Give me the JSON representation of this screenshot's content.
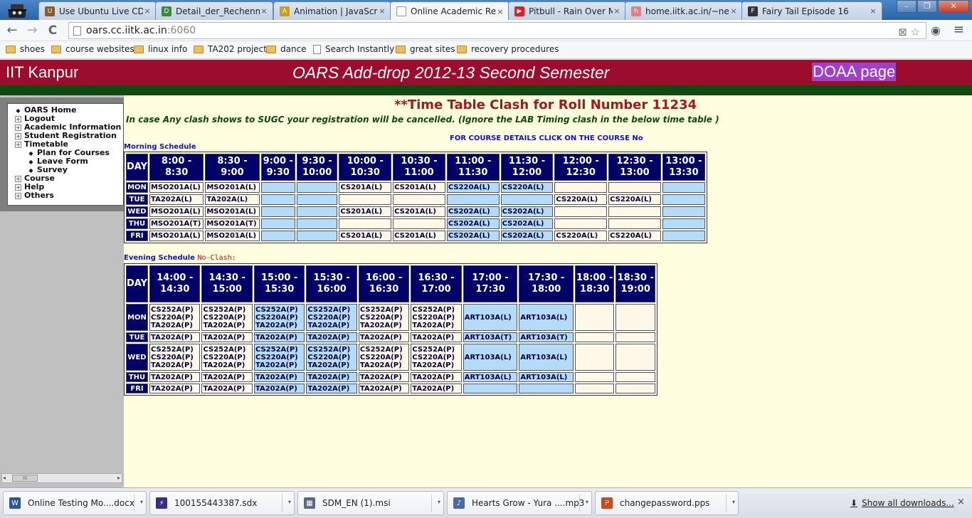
{
  "browser": {
    "tabs": [
      {
        "label": "Use Ubuntu Live CD",
        "color": "#8b5a2b",
        "glyph": "U"
      },
      {
        "label": "Detail_der_Rechenm",
        "color": "#3a8a3a",
        "glyph": "D"
      },
      {
        "label": "Animation | JavaScri",
        "color": "#c8a020",
        "glyph": "A"
      },
      {
        "label": "Online Academic Re",
        "color": "#ffffff",
        "glyph": "",
        "active": true
      },
      {
        "label": "Pitbull - Rain Over M",
        "color": "#e02020",
        "glyph": "▶"
      },
      {
        "label": "home.iitk.ac.in/~nee",
        "color": "#e08080",
        "glyph": "h"
      },
      {
        "label": "Fairy Tail Episode 16",
        "color": "#333333",
        "glyph": "F"
      }
    ],
    "tab_close_glyph": "×",
    "window_buttons": {
      "minimize": "–",
      "restore": "❐",
      "close": "✕"
    },
    "nav": {
      "back": "←",
      "forward": "→",
      "reload": "C"
    },
    "url": {
      "host": "oars.cc.iitk.ac.in",
      "port": ":6060"
    },
    "omni_icons": "⊠ ☆",
    "toolbar_icons": {
      "eye": "◉",
      "wrench": "≡"
    },
    "bookmarks": [
      {
        "label": "shoes",
        "type": "folder"
      },
      {
        "label": "course websites",
        "type": "folder"
      },
      {
        "label": "linux info",
        "type": "folder"
      },
      {
        "label": "TA202 project",
        "type": "folder"
      },
      {
        "label": "dance",
        "type": "folder"
      },
      {
        "label": "Search Instantly",
        "type": "page"
      },
      {
        "label": "great sites",
        "type": "folder"
      },
      {
        "label": "recovery procedures",
        "type": "folder"
      }
    ]
  },
  "banner": {
    "left": "IIT Kanpur",
    "center": "OARS Add-drop 2012-13 Second Semester",
    "right": "DOAA page"
  },
  "menu": [
    {
      "label": "OARS Home",
      "icon": "◆",
      "sub": false
    },
    {
      "label": "Logout",
      "icon": "+",
      "sub": false
    },
    {
      "label": "Academic Information",
      "icon": "+",
      "sub": false
    },
    {
      "label": "Student Registration",
      "icon": "+",
      "sub": false
    },
    {
      "label": "Timetable",
      "icon": "+",
      "sub": false
    },
    {
      "label": "Plan for Courses",
      "icon": "◆",
      "sub": true
    },
    {
      "label": "Leave Form",
      "icon": "◆",
      "sub": true
    },
    {
      "label": "Survey",
      "icon": "◆",
      "sub": true
    },
    {
      "label": "Course",
      "icon": "+",
      "sub": false
    },
    {
      "label": "Help",
      "icon": "+",
      "sub": false
    },
    {
      "label": "Others",
      "icon": "+",
      "sub": false
    }
  ],
  "scrollbar": {
    "left": "◂",
    "thumb": "III",
    "right": "▸"
  },
  "content": {
    "heading": "**Time Table Clash for Roll Number 11234",
    "note": "In case Any clash shows to SUGC your registration will be cancelled. (Ignore the LAB Timing clash in the below time table )",
    "course_details": "FOR COURSE DETAILS CLICK ON THE COURSE No",
    "morning_label": "Morning Schedule",
    "evening_label": "Evening Schedule",
    "evening_status": "No-Clash:"
  },
  "morning": {
    "day_header": "DAY",
    "slots": [
      "8:00 - 8:30",
      "8:30 - 9:00",
      "9:00 - 9:30",
      "9:30 - 10:00",
      "10:00 - 10:30",
      "10:30 - 11:00",
      "11:00 - 11:30",
      "11:30 - 12:00",
      "12:00 - 12:30",
      "12:30 - 13:00",
      "13:00 - 13:30"
    ],
    "blue_cols": [
      2,
      3,
      6,
      7,
      10
    ],
    "rows": [
      {
        "day": "MON",
        "cells": [
          "MSO201A(L)",
          "MSO201A(L)",
          "",
          "",
          "CS201A(L)",
          "CS201A(L)",
          "CS220A(L)",
          "CS220A(L)",
          "",
          "",
          ""
        ]
      },
      {
        "day": "TUE",
        "cells": [
          "TA202A(L)",
          "TA202A(L)",
          "",
          "",
          "",
          "",
          "",
          "",
          "CS220A(L)",
          "CS220A(L)",
          ""
        ]
      },
      {
        "day": "WED",
        "cells": [
          "MSO201A(L)",
          "MSO201A(L)",
          "",
          "",
          "CS201A(L)",
          "CS201A(L)",
          "CS202A(L)",
          "CS202A(L)",
          "",
          "",
          ""
        ]
      },
      {
        "day": "THU",
        "cells": [
          "MSO201A(T)",
          "MSO201A(T)",
          "",
          "",
          "",
          "",
          "CS202A(L)",
          "CS202A(L)",
          "",
          "",
          ""
        ]
      },
      {
        "day": "FRI",
        "cells": [
          "MSO201A(L)",
          "MSO201A(L)",
          "",
          "",
          "CS201A(L)",
          "CS201A(L)",
          "CS202A(L)",
          "CS202A(L)",
          "CS220A(L)",
          "CS220A(L)",
          ""
        ]
      }
    ]
  },
  "evening": {
    "day_header": "DAY",
    "slots": [
      "14:00 - 14:30",
      "14:30 - 15:00",
      "15:00 - 15:30",
      "15:30 - 16:00",
      "16:00 - 16:30",
      "16:30 - 17:00",
      "17:00 - 17:30",
      "17:30 - 18:00",
      "18:00 - 18:30",
      "18:30 - 19:00"
    ],
    "blue_cols": [
      2,
      3,
      6,
      7
    ],
    "rows": [
      {
        "day": "MON",
        "cells": [
          [
            "CS252A(P)",
            "CS220A(P)",
            "TA202A(P)"
          ],
          [
            "CS252A(P)",
            "CS220A(P)",
            "TA202A(P)"
          ],
          [
            "CS252A(P)",
            "CS220A(P)",
            "TA202A(P)"
          ],
          [
            "CS252A(P)",
            "CS220A(P)",
            "TA202A(P)"
          ],
          [
            "CS252A(P)",
            "CS220A(P)",
            "TA202A(P)"
          ],
          [
            "CS252A(P)",
            "CS220A(P)",
            "TA202A(P)"
          ],
          [
            "ART103A(L)"
          ],
          [
            "ART103A(L)"
          ],
          [],
          []
        ]
      },
      {
        "day": "TUE",
        "cells": [
          [
            "TA202A(P)"
          ],
          [
            "TA202A(P)"
          ],
          [
            "TA202A(P)"
          ],
          [
            "TA202A(P)"
          ],
          [
            "TA202A(P)"
          ],
          [
            "TA202A(P)"
          ],
          [
            "ART103A(T)"
          ],
          [
            "ART103A(T)"
          ],
          [],
          []
        ]
      },
      {
        "day": "WED",
        "cells": [
          [
            "CS252A(P)",
            "CS220A(P)",
            "TA202A(P)"
          ],
          [
            "CS252A(P)",
            "CS220A(P)",
            "TA202A(P)"
          ],
          [
            "CS252A(P)",
            "CS220A(P)",
            "TA202A(P)"
          ],
          [
            "CS252A(P)",
            "CS220A(P)",
            "TA202A(P)"
          ],
          [
            "CS252A(P)",
            "CS220A(P)",
            "TA202A(P)"
          ],
          [
            "CS252A(P)",
            "CS220A(P)",
            "TA202A(P)"
          ],
          [
            "ART103A(L)"
          ],
          [
            "ART103A(L)"
          ],
          [],
          []
        ]
      },
      {
        "day": "THU",
        "cells": [
          [
            "TA202A(P)"
          ],
          [
            "TA202A(P)"
          ],
          [
            "TA202A(P)"
          ],
          [
            "TA202A(P)"
          ],
          [
            "TA202A(P)"
          ],
          [
            "TA202A(P)"
          ],
          [
            "ART103A(L)"
          ],
          [
            "ART103A(L)"
          ],
          [],
          []
        ]
      },
      {
        "day": "FRI",
        "cells": [
          [
            "TA202A(P)"
          ],
          [
            "TA202A(P)"
          ],
          [
            "TA202A(P)"
          ],
          [
            "TA202A(P)"
          ],
          [
            "TA202A(P)"
          ],
          [
            "TA202A(P)"
          ],
          [],
          [],
          [],
          []
        ]
      }
    ]
  },
  "downloads": {
    "items": [
      {
        "label": "Online Testing Mo....docx",
        "icon": "W",
        "color": "#2b5797"
      },
      {
        "label": "100155443387.sdx",
        "icon": "⚡",
        "color": "#3a2a8a"
      },
      {
        "label": "SDM_EN (1).msi",
        "icon": "▦",
        "color": "#5a6a7a"
      },
      {
        "label": "Hearts Grow - Yura ....mp3",
        "icon": "♪",
        "color": "#4a6aa0"
      },
      {
        "label": "changepassword.pps",
        "icon": "P",
        "color": "#c84a20"
      }
    ],
    "menu_glyph": "▾",
    "show_all": "Show all downloads...",
    "show_all_icon": "⬇",
    "close": "×"
  }
}
